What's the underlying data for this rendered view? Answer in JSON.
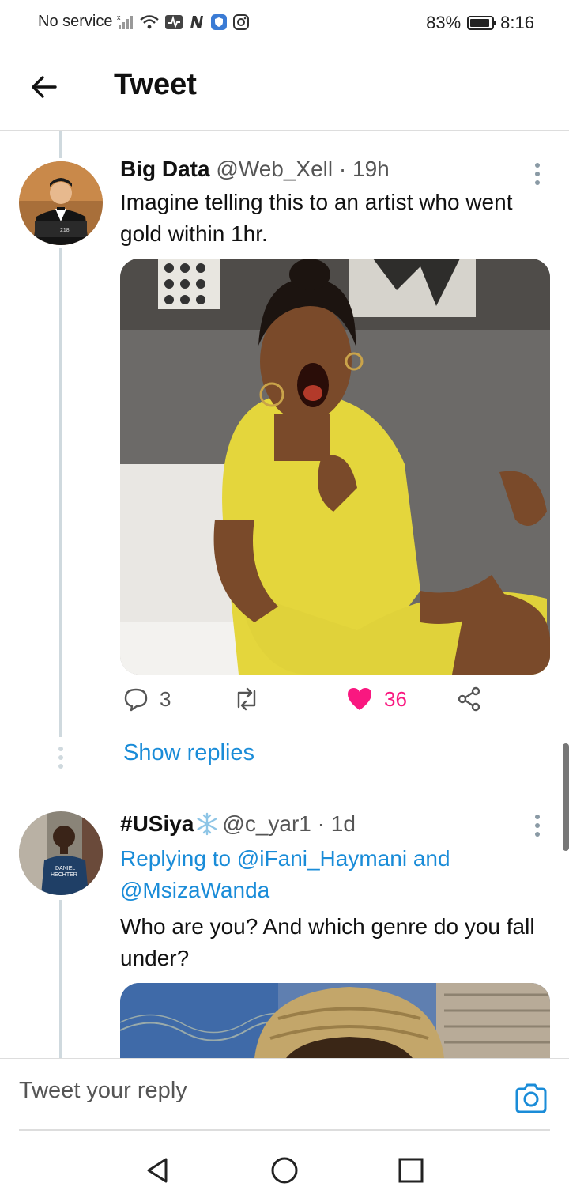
{
  "status_bar": {
    "carrier": "No service",
    "battery": "83%",
    "time": "8:16",
    "icons": [
      "signal-icon",
      "wifi-icon",
      "activity-icon",
      "n-icon",
      "shield-icon",
      "instagram-icon"
    ]
  },
  "header": {
    "title": "Tweet"
  },
  "tweet1": {
    "name": "Big Data",
    "handle": "@Web_Xell",
    "dot": "·",
    "time": "19h",
    "text": "Imagine telling this to an artist who went gold within 1hr.",
    "replies": "3",
    "likes": "36",
    "like_color": "#f91880"
  },
  "show_replies": "Show replies",
  "tweet2": {
    "name": "#USiya",
    "handle": "@c_yar1",
    "dot": "·",
    "time": "1d",
    "replying_prefix": "Replying to ",
    "replying_user1": "@iFani_Haymani",
    "replying_and": " and",
    "replying_user2": "@MsizaWanda",
    "text": "Who are you? And which genre do you fall under?",
    "avatar_shirt_text_line1": "DANIEL",
    "avatar_shirt_text_line2": "HECHTER"
  },
  "reply_box": {
    "placeholder": "Tweet your reply"
  },
  "colors": {
    "accent": "#1a8cd8",
    "like": "#f91880"
  }
}
